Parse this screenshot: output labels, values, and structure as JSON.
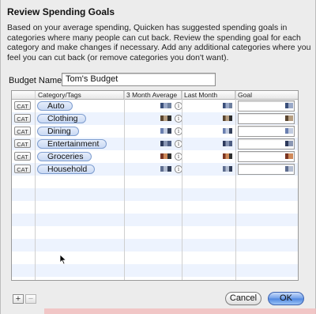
{
  "dialog": {
    "title": "Review Spending Goals",
    "description": "Based on your average spending, Quicken has suggested spending goals in categories where many people can cut back.  Review the spending goal for each category and make changes if necessary.  Add any additional categories where you feel you can cut back (or remove categories you don't want).",
    "budget_name_label": "Budget Name:",
    "budget_name_value": "Tom's Budget"
  },
  "table": {
    "columns": [
      "Category/Tags",
      "3 Month Average",
      "Last Month",
      "Goal"
    ],
    "rows": [
      {
        "cat": "CAT",
        "category": "Auto"
      },
      {
        "cat": "CAT",
        "category": "Clothing"
      },
      {
        "cat": "CAT",
        "category": "Dining"
      },
      {
        "cat": "CAT",
        "category": "Entertainment"
      },
      {
        "cat": "CAT",
        "category": "Groceries"
      },
      {
        "cat": "CAT",
        "category": "Household"
      }
    ],
    "info_glyph": "i"
  },
  "footer": {
    "add_label": "+",
    "remove_label": "−",
    "cancel_label": "Cancel",
    "ok_label": "OK"
  },
  "colors": {
    "selection_blue": "#edf3fe",
    "pill_blue": "#c8d8f3",
    "ok_blue": "#4f86e0"
  },
  "icons": {
    "info": "info-icon",
    "pointer": "arrow-cursor-icon"
  }
}
